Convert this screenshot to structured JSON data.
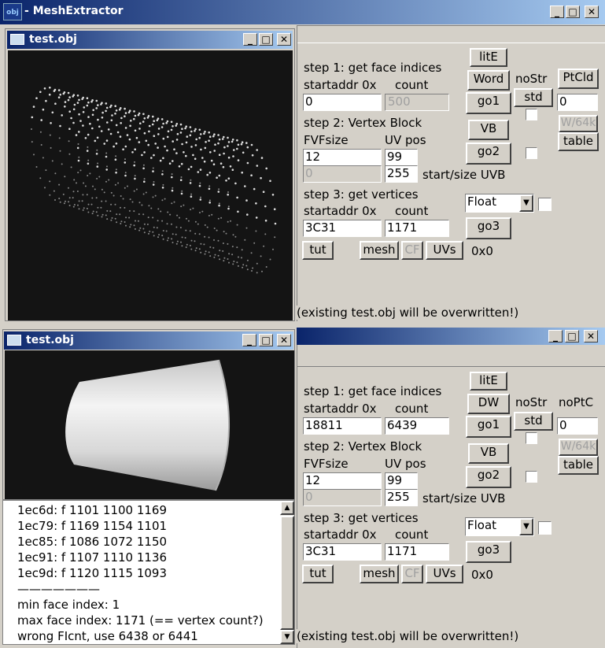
{
  "app": {
    "title": "MeshExtractor",
    "icon_text": "obj"
  },
  "top_window": {
    "title": "test.obj"
  },
  "bottom_window": {
    "title": "test.obj"
  },
  "panel_top": {
    "step1": "step 1: get face indices",
    "startaddr_label": "startaddr 0x",
    "count_label": "count",
    "startaddr": "0",
    "count": "500",
    "step2": "step 2: Vertex Block",
    "fvf_label": "FVFsize",
    "uvpos_label": "UV pos",
    "fvfsize": "12",
    "uvpos": "99",
    "uvb_start": "0",
    "uvb_size": "255",
    "uvb_label": "start/size UVB",
    "step3": "step 3: get vertices",
    "startaddr3_label": "startaddr 0x",
    "count3_label": "count",
    "startaddr3": "3C31",
    "count3": "1171",
    "format": "Float",
    "btn_lite": "litE",
    "btn_word": "Word",
    "btn_nostr": "noStr",
    "btn_std": "std",
    "btn_ptcld": "PtCld",
    "ptcld_val": "0",
    "btn_go1": "go1",
    "btn_vb": "VB",
    "btn_w64k": "W/64k",
    "btn_table": "table",
    "btn_go2": "go2",
    "btn_go3": "go3",
    "btn_tut": "tut",
    "btn_mesh": "mesh",
    "btn_cf": "CF",
    "btn_uvs": "UVs",
    "hex": "0x0",
    "status": "(existing test.obj will be overwritten!)"
  },
  "panel_bottom": {
    "step1": "step 1: get face indices",
    "startaddr_label": "startaddr 0x",
    "count_label": "count",
    "startaddr": "18811",
    "count": "6439",
    "step2": "step 2: Vertex Block",
    "fvf_label": "FVFsize",
    "uvpos_label": "UV pos",
    "fvfsize": "12",
    "uvpos": "99",
    "uvb_start": "0",
    "uvb_size": "255",
    "uvb_label": "start/size UVB",
    "step3": "step 3: get vertices",
    "startaddr3_label": "startaddr 0x",
    "count3_label": "count",
    "startaddr3": "3C31",
    "count3": "1171",
    "format": "Float",
    "btn_lite": "litE",
    "btn_dw": "DW",
    "btn_nostr": "noStr",
    "btn_std": "std",
    "btn_noptc": "noPtC",
    "ptc_val": "0",
    "btn_go1": "go1",
    "btn_vb": "VB",
    "btn_w64k": "W/64k",
    "btn_table": "table",
    "btn_go2": "go2",
    "btn_go3": "go3",
    "btn_tut": "tut",
    "btn_mesh": "mesh",
    "btn_cf": "CF",
    "btn_uvs": "UVs",
    "hex": "0x0",
    "status": "(existing test.obj will be overwritten!)"
  },
  "log": {
    "lines": [
      "1ec6d: f  1101 1100 1169",
      "1ec79: f  1169 1154 1101",
      "1ec85: f  1086 1072 1150",
      "1ec91: f  1107 1110 1136",
      "1ec9d: f  1120 1115 1093",
      "———————",
      "min face index: 1",
      "max face index: 1171 (== vertex count?)",
      "wrong FIcnt, use 6438 or 6441"
    ]
  },
  "window_controls": {
    "minimize": "_",
    "maximize": "□",
    "close": "✕"
  },
  "scroll": {
    "up": "▲",
    "down": "▼",
    "dropdown": "▼"
  }
}
